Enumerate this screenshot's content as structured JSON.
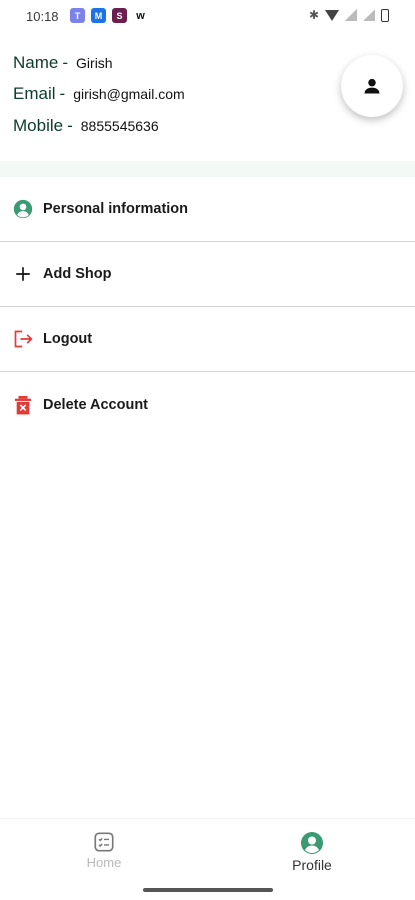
{
  "status_bar": {
    "time": "10:18",
    "left_icons": [
      "teams-icon",
      "meet-icon",
      "slack-icon",
      "w-icon"
    ],
    "w_label": "w",
    "right_icons": [
      "bluetooth-icon",
      "wifi-icon",
      "signal-off-icon",
      "signal-off-icon",
      "battery-icon"
    ]
  },
  "profile": {
    "name_label": "Name",
    "name_value": "Girish",
    "email_label": "Email",
    "email_value": "girish@gmail.com",
    "mobile_label": "Mobile",
    "mobile_value": "8855545636",
    "separator": "-"
  },
  "menu": {
    "items": [
      {
        "label": "Personal information",
        "icon": "user-circle-icon"
      },
      {
        "label": "Add Shop",
        "icon": "plus-icon"
      },
      {
        "label": "Logout",
        "icon": "logout-icon"
      },
      {
        "label": "Delete Account",
        "icon": "delete-icon"
      }
    ]
  },
  "bottom_nav": {
    "items": [
      {
        "label": "Home",
        "icon": "home-list-icon",
        "active": false
      },
      {
        "label": "Profile",
        "icon": "profile-icon",
        "active": true
      }
    ]
  },
  "colors": {
    "accent": "#3a9a72",
    "danger": "#e53935",
    "label_dark": "#0d3b2a",
    "band": "#f3faf6"
  }
}
